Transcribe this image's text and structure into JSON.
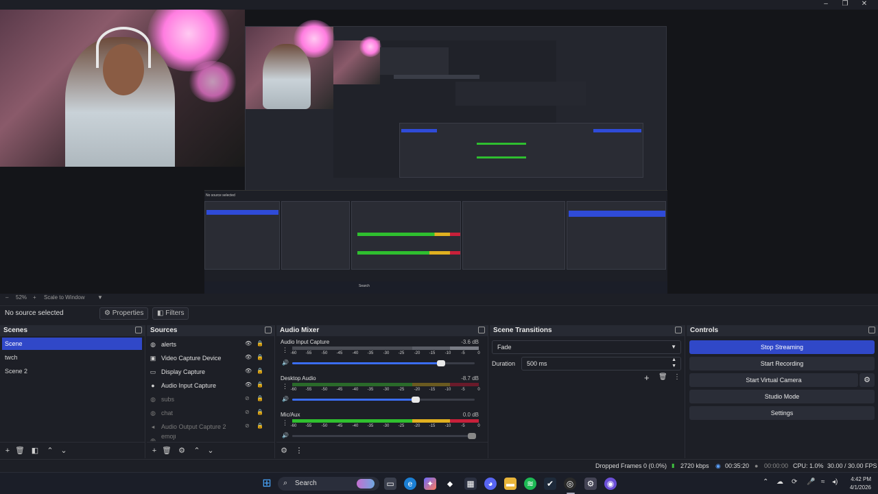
{
  "window": {
    "minimize_icon": "minimize-icon",
    "restore_icon": "restore-icon",
    "close_icon": "close-icon"
  },
  "preview": {
    "nested_scale_label": "Scale to Window",
    "nested_no_source": "No source selected",
    "nested_taskbar_search": "Search"
  },
  "zoombar": {
    "zoom": "52%",
    "scale_mode": "Scale to Window"
  },
  "toolbar": {
    "no_source": "No source selected",
    "properties": "Properties",
    "filters": "Filters"
  },
  "scenes": {
    "title": "Scenes",
    "items": [
      "Scene",
      "twch",
      "Scene 2"
    ],
    "active_index": 0
  },
  "sources": {
    "title": "Sources",
    "items": [
      {
        "label": "alerts",
        "icon": "globe-icon",
        "visible": true
      },
      {
        "label": "Video Capture Device",
        "icon": "camera-icon",
        "visible": true
      },
      {
        "label": "Display Capture",
        "icon": "monitor-icon",
        "visible": true
      },
      {
        "label": "Audio Input Capture",
        "icon": "mic-icon",
        "visible": true
      },
      {
        "label": "subs",
        "icon": "globe-icon",
        "visible": false
      },
      {
        "label": "chat",
        "icon": "globe-icon",
        "visible": false
      },
      {
        "label": "Audio Output Capture 2",
        "icon": "speaker-icon",
        "visible": false
      },
      {
        "label": "emoji",
        "icon": "globe-icon",
        "visible": false
      }
    ]
  },
  "mixer": {
    "title": "Audio Mixer",
    "ticks": [
      "-60",
      "-55",
      "-50",
      "-45",
      "-40",
      "-35",
      "-30",
      "-25",
      "-20",
      "-15",
      "-10",
      "-5",
      "0"
    ],
    "channels": [
      {
        "name": "Audio Input Capture",
        "db": "-3.6 dB",
        "volume": 0.83
      },
      {
        "name": "Desktop Audio",
        "db": "-8.7 dB",
        "volume": 0.69
      },
      {
        "name": "Mic/Aux",
        "db": "0.0 dB",
        "volume": 1.0
      }
    ]
  },
  "transitions": {
    "title": "Scene Transitions",
    "selected": "Fade",
    "duration_label": "Duration",
    "duration_value": "500 ms"
  },
  "controls": {
    "title": "Controls",
    "stop_streaming": "Stop Streaming",
    "start_recording": "Start Recording",
    "start_virtual_camera": "Start Virtual Camera",
    "studio_mode": "Studio Mode",
    "settings": "Settings"
  },
  "status": {
    "dropped": "Dropped Frames 0 (0.0%)",
    "bitrate": "2720 kbps",
    "stream_time": "00:35:20",
    "rec_time": "00:00:00",
    "cpu": "CPU: 1.0%",
    "fps": "30.00 / 30.00 FPS"
  },
  "taskbar": {
    "search": "Search",
    "time": "4:42 PM",
    "date": "4/1/2026"
  },
  "colors": {
    "accent": "#3048c8",
    "meter_green": "#2fbf2f",
    "meter_yellow": "#e0b020",
    "meter_red": "#c8203a"
  }
}
